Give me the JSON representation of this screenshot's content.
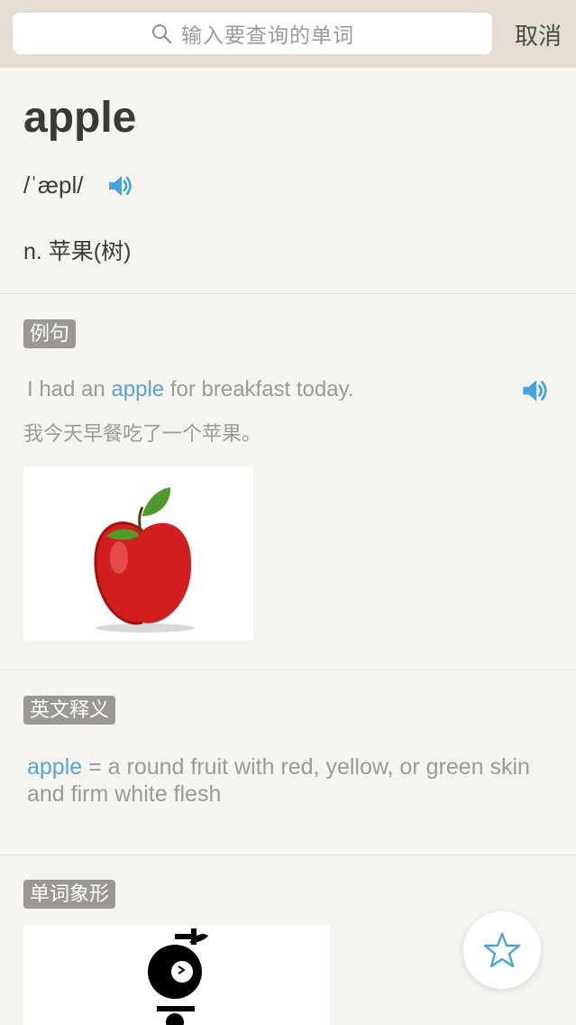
{
  "search": {
    "placeholder": "输入要查询的单词",
    "cancel_label": "取消"
  },
  "entry": {
    "word": "apple",
    "phonetic": "/ˈæpl/",
    "definition": "n. 苹果(树)"
  },
  "examples_section": {
    "tag": "例句",
    "sentence_before": "I had an ",
    "sentence_highlight": "apple",
    "sentence_after": " for breakfast today.",
    "translation": "我今天早餐吃了一个苹果。"
  },
  "english_def_section": {
    "tag": "英文释义",
    "word_highlight": "apple",
    "definition_text": " = a round fruit with red, yellow, or green skin and firm white flesh"
  },
  "pictograph_section": {
    "tag": "单词象形"
  },
  "colors": {
    "accent": "#5aa3d8",
    "background": "#f6f4ef",
    "tag_bg": "#9b9893"
  },
  "icons": [
    "search-icon",
    "speaker-icon",
    "star-icon",
    "apple-image",
    "pictograph-image"
  ]
}
